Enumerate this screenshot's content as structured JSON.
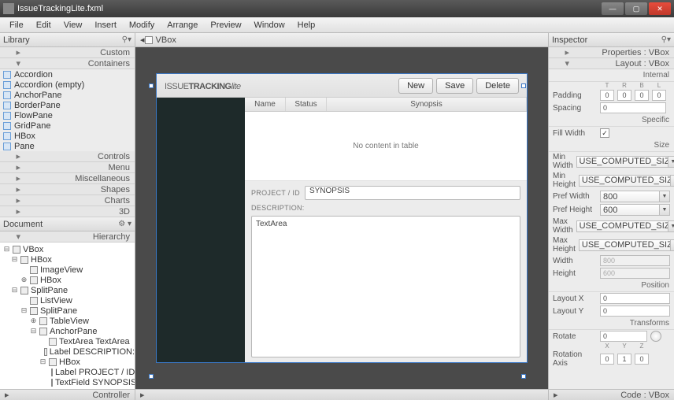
{
  "window": {
    "title": "IssueTrackingLite.fxml"
  },
  "menu": [
    "File",
    "Edit",
    "View",
    "Insert",
    "Modify",
    "Arrange",
    "Preview",
    "Window",
    "Help"
  ],
  "library": {
    "title": "Library",
    "sections_top": [
      "Custom",
      "Containers"
    ],
    "containers": [
      "Accordion",
      "Accordion (empty)",
      "AnchorPane",
      "BorderPane",
      "FlowPane",
      "GridPane",
      "HBox",
      "Pane"
    ],
    "sections_bottom": [
      "Controls",
      "Menu",
      "Miscellaneous",
      "Shapes",
      "Charts",
      "3D"
    ]
  },
  "document": {
    "title": "Document",
    "hierarchy_label": "Hierarchy",
    "tree": [
      {
        "d": 0,
        "tw": "⊟",
        "label": "VBox"
      },
      {
        "d": 1,
        "tw": "⊟",
        "label": "HBox"
      },
      {
        "d": 2,
        "tw": "",
        "label": "ImageView"
      },
      {
        "d": 2,
        "tw": "⊕",
        "label": "HBox"
      },
      {
        "d": 1,
        "tw": "⊟",
        "label": "SplitPane"
      },
      {
        "d": 2,
        "tw": "",
        "label": "ListView"
      },
      {
        "d": 2,
        "tw": "⊟",
        "label": "SplitPane"
      },
      {
        "d": 3,
        "tw": "⊕",
        "label": "TableView"
      },
      {
        "d": 3,
        "tw": "⊟",
        "label": "AnchorPane"
      },
      {
        "d": 4,
        "tw": "",
        "label": "TextArea TextArea"
      },
      {
        "d": 4,
        "tw": "",
        "label": "Label DESCRIPTION:"
      },
      {
        "d": 4,
        "tw": "⊟",
        "label": "HBox"
      },
      {
        "d": 5,
        "tw": "",
        "label": "Label PROJECT / ID"
      },
      {
        "d": 5,
        "tw": "",
        "label": "TextField SYNOPSIS"
      }
    ],
    "controller_label": "Controller"
  },
  "design": {
    "tab": "VBox",
    "app_title_a": "ISSUE",
    "app_title_b": "TRACKING",
    "app_title_c": "lite",
    "buttons": {
      "new": "New",
      "save": "Save",
      "delete": "Delete"
    },
    "columns": {
      "name": "Name",
      "status": "Status",
      "synopsis": "Synopsis"
    },
    "no_content": "No content in table",
    "form": {
      "projid": "PROJECT / ID",
      "synopsis_val": "SYNOPSIS",
      "desc": "DESCRIPTION:",
      "textarea": "TextArea"
    }
  },
  "inspector": {
    "title": "Inspector",
    "props_header": "Properties : VBox",
    "layout_header": "Layout : VBox",
    "sections": {
      "internal": "Internal",
      "specific": "Specific",
      "size": "Size",
      "position": "Position",
      "transforms": "Transforms"
    },
    "trbl": [
      "T",
      "R",
      "B",
      "L"
    ],
    "padding_label": "Padding",
    "padding": [
      "0",
      "0",
      "0",
      "0"
    ],
    "spacing_label": "Spacing",
    "spacing": "0",
    "fillwidth_label": "Fill Width",
    "minw_label": "Min Width",
    "minw": "USE_COMPUTED_SIZE",
    "minh_label": "Min Height",
    "minh": "USE_COMPUTED_SIZE",
    "prefw_label": "Pref Width",
    "prefw": "800",
    "prefh_label": "Pref Height",
    "prefh": "600",
    "maxw_label": "Max Width",
    "maxw": "USE_COMPUTED_SIZE",
    "maxh_label": "Max Height",
    "maxh": "USE_COMPUTED_SIZE",
    "width_label": "Width",
    "width": "800",
    "height_label": "Height",
    "height": "600",
    "layoutx_label": "Layout X",
    "layoutx": "0",
    "layouty_label": "Layout Y",
    "layouty": "0",
    "rotate_label": "Rotate",
    "rotate": "0",
    "rotaxis_label": "Rotation Axis",
    "xyz": [
      "X",
      "Y",
      "Z"
    ],
    "rotaxis": [
      "0",
      "1",
      "0"
    ],
    "code_header": "Code : VBox"
  }
}
